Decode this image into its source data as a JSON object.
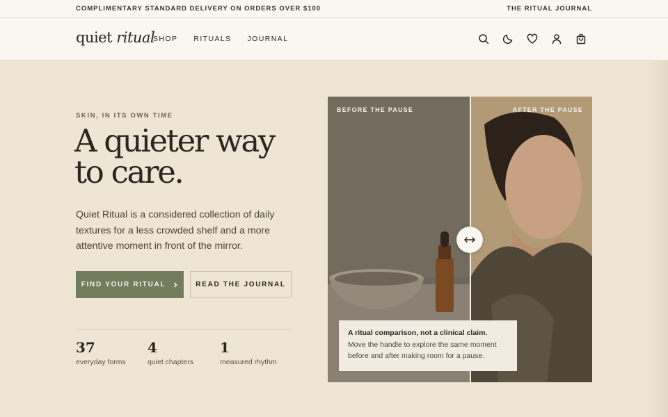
{
  "announcement": {
    "text": "COMPLIMENTARY STANDARD DELIVERY ON ORDERS OVER $100",
    "link": "THE RITUAL JOURNAL"
  },
  "header": {
    "logo_regular": "quiet ",
    "logo_italic": "ritual",
    "nav": [
      "SHOP",
      "RITUALS",
      "JOURNAL"
    ],
    "icons": [
      "search-icon",
      "moon-icon",
      "heart-icon",
      "user-icon",
      "bag-icon"
    ]
  },
  "hero": {
    "eyebrow": "SKIN, IN ITS OWN TIME",
    "headline": "A quieter way to care.",
    "lede": "Quiet Ritual is a considered collection of daily textures for a less crowded shelf and a more attentive moment in front of the mirror.",
    "primary_cta": "FIND YOUR RITUAL",
    "secondary_cta": "READ THE JOURNAL",
    "stats": [
      {
        "num": "37",
        "label": "everyday forms"
      },
      {
        "num": "4",
        "label": "quiet chapters"
      },
      {
        "num": "1",
        "label": "measured rhythm"
      }
    ]
  },
  "comparison": {
    "before_label": "BEFORE THE PAUSE",
    "after_label": "AFTER THE PAUSE",
    "caption_title": "A ritual comparison, not a clinical claim.",
    "caption_body": "Move the handle to explore the same moment before and after making room for a pause."
  },
  "colors": {
    "background": "#efe5d5",
    "header": "#faf6f0",
    "accent": "#737c5c",
    "text": "#2c2620"
  }
}
